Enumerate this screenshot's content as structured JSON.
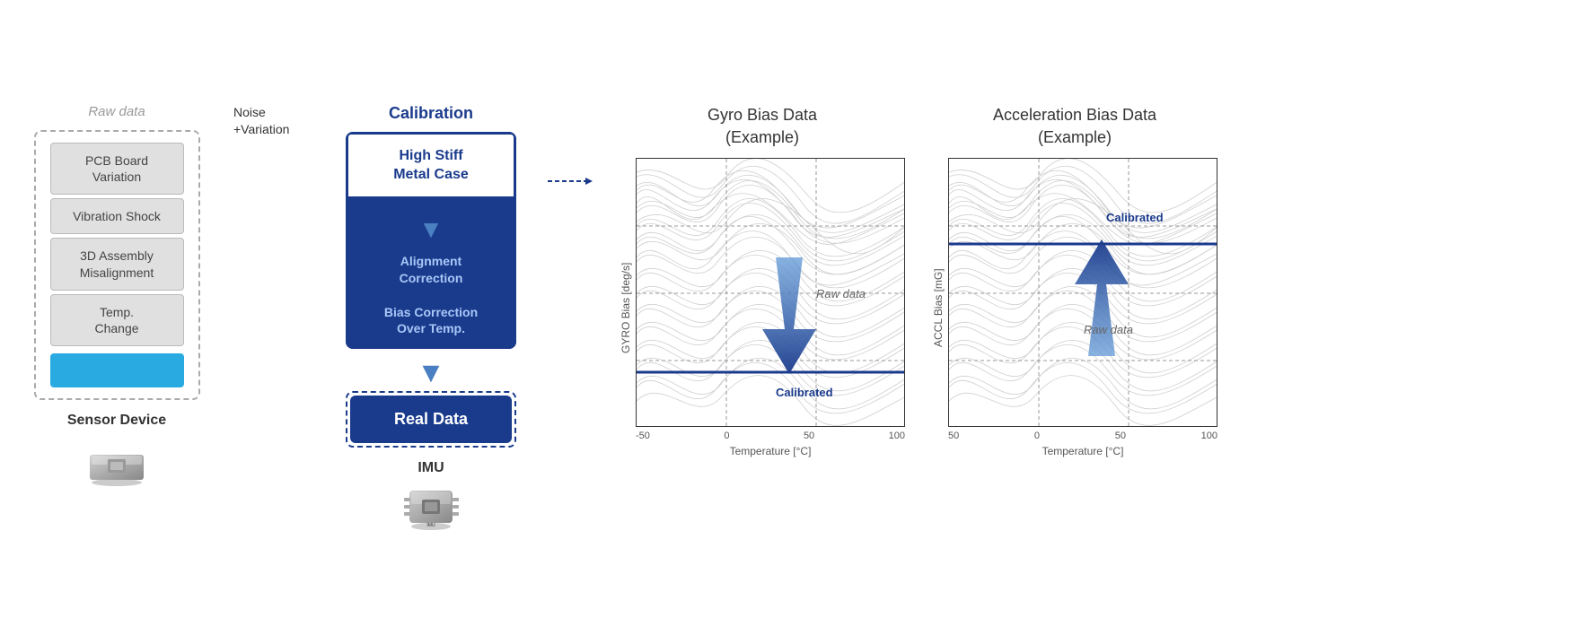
{
  "rawData": {
    "label": "Raw data",
    "items": [
      "PCB Board\nVariation",
      "Vibration Shock",
      "3D Assembly\nMisalignment",
      "Temp.\nChange"
    ]
  },
  "noiseLabel": "Noise\n+Variation",
  "sensorDeviceLabel": "Sensor Device",
  "calibration": {
    "title": "Calibration",
    "items": [
      {
        "label": "High Stiff\nMetal Case",
        "style": "top"
      },
      {
        "label": "Alignment\nCorrection",
        "style": "bottom"
      },
      {
        "label": "Bias Correction\nOver Temp.",
        "style": "bottom"
      }
    ],
    "realDataLabel": "Real Data"
  },
  "imuLabel": "IMU",
  "charts": [
    {
      "title": "Gyro Bias Data\n(Example)",
      "yLabel": "GYRO Bias [deg/s]",
      "xLabel": "Temperature [°C]",
      "xTicks": [
        "-50",
        "",
        "0",
        "",
        "50",
        "",
        "100"
      ],
      "rawDataLabel": "Raw data",
      "calibratedLabel": "Calibrated"
    },
    {
      "title": "Acceleration Bias Data\n(Example)",
      "yLabel": "ACCL Bias [mG]",
      "xLabel": "Temperature [°C]",
      "xTicks": [
        "50",
        "",
        "0",
        "",
        "50",
        "",
        "100"
      ],
      "rawDataLabel": "Raw data",
      "calibratedLabel": "Calibrated"
    }
  ],
  "colors": {
    "darkBlue": "#1a3a8c",
    "lightBlue": "#29abe2",
    "medBlue": "#4a7fc1",
    "gray": "#aaa",
    "darkGray": "#666"
  }
}
